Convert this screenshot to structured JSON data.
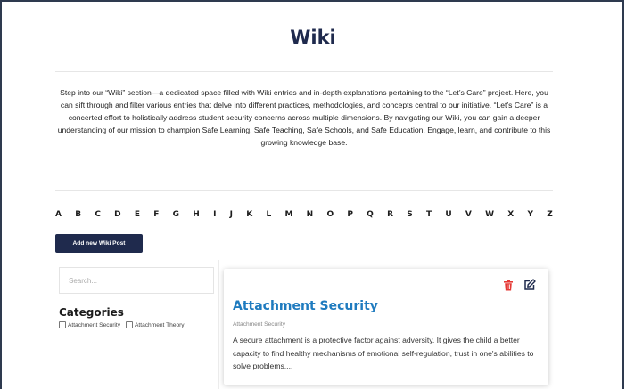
{
  "page": {
    "title": "Wiki",
    "intro": "Step into our “Wiki” section—a dedicated space filled with Wiki entries and in-depth explanations pertaining to the “Let’s Care” project. Here, you can sift through and filter various entries that delve into different practices, methodologies, and concepts central to our initiative. “Let’s Care” is a concerted effort to holistically address student security concerns across multiple dimensions. By navigating our Wiki, you can gain a deeper understanding of our mission to champion Safe Learning, Safe Teaching, Safe Schools, and Safe Education. Engage, learn, and contribute to this growing knowledge base."
  },
  "alphabet": [
    "A",
    "B",
    "C",
    "D",
    "E",
    "F",
    "G",
    "H",
    "I",
    "J",
    "K",
    "L",
    "M",
    "N",
    "O",
    "P",
    "Q",
    "R",
    "S",
    "T",
    "U",
    "V",
    "W",
    "X",
    "Y",
    "Z"
  ],
  "toolbar": {
    "add_label": "Add new Wiki Post"
  },
  "search": {
    "placeholder": "Search..."
  },
  "categories": {
    "title": "Categories",
    "items": [
      {
        "label": "Attachment Security",
        "checked": false
      },
      {
        "label": "Attachment Theory",
        "checked": false
      }
    ]
  },
  "entry": {
    "title": "Attachment Security",
    "category": "Attachment Security",
    "excerpt": "A secure attachment is a protective factor against adversity. It gives the child a better capacity to find healthy mechanisms of emotional self-regulation, trust in one's abilities to solve problems,...",
    "delete_icon": "trash-icon",
    "edit_icon": "edit-icon",
    "delete_color": "#e53935",
    "edit_color": "#1f2a4d"
  },
  "colors": {
    "brand": "#1f2a4d",
    "link": "#1f7bbf"
  }
}
